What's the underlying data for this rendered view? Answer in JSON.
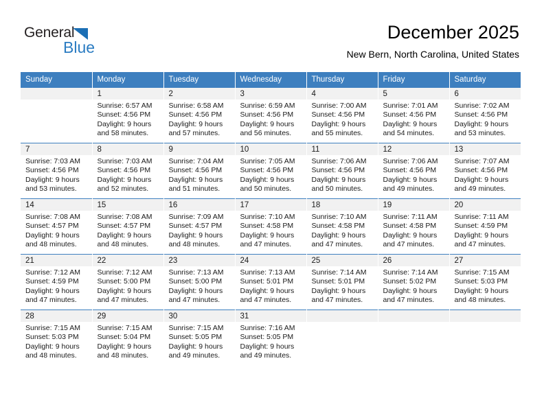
{
  "brand": {
    "name_part1": "General",
    "name_part2": "Blue",
    "accent_color": "#2b7cc2",
    "triangle_color": "#1c6fb5"
  },
  "header": {
    "title": "December 2025",
    "subtitle": "New Bern, North Carolina, United States"
  },
  "theme": {
    "header_row_bg": "#3d7fbf",
    "header_row_text": "#ffffff",
    "daynum_band_bg": "#f1f1f1",
    "cell_bg": "#ffffff",
    "row_divider": "#3d7fbf"
  },
  "calendar": {
    "weekday_headers": [
      "Sunday",
      "Monday",
      "Tuesday",
      "Wednesday",
      "Thursday",
      "Friday",
      "Saturday"
    ],
    "weeks": [
      [
        {
          "day": "",
          "lines": []
        },
        {
          "day": "1",
          "lines": [
            "Sunrise: 6:57 AM",
            "Sunset: 4:56 PM",
            "Daylight: 9 hours",
            "and 58 minutes."
          ]
        },
        {
          "day": "2",
          "lines": [
            "Sunrise: 6:58 AM",
            "Sunset: 4:56 PM",
            "Daylight: 9 hours",
            "and 57 minutes."
          ]
        },
        {
          "day": "3",
          "lines": [
            "Sunrise: 6:59 AM",
            "Sunset: 4:56 PM",
            "Daylight: 9 hours",
            "and 56 minutes."
          ]
        },
        {
          "day": "4",
          "lines": [
            "Sunrise: 7:00 AM",
            "Sunset: 4:56 PM",
            "Daylight: 9 hours",
            "and 55 minutes."
          ]
        },
        {
          "day": "5",
          "lines": [
            "Sunrise: 7:01 AM",
            "Sunset: 4:56 PM",
            "Daylight: 9 hours",
            "and 54 minutes."
          ]
        },
        {
          "day": "6",
          "lines": [
            "Sunrise: 7:02 AM",
            "Sunset: 4:56 PM",
            "Daylight: 9 hours",
            "and 53 minutes."
          ]
        }
      ],
      [
        {
          "day": "7",
          "lines": [
            "Sunrise: 7:03 AM",
            "Sunset: 4:56 PM",
            "Daylight: 9 hours",
            "and 53 minutes."
          ]
        },
        {
          "day": "8",
          "lines": [
            "Sunrise: 7:03 AM",
            "Sunset: 4:56 PM",
            "Daylight: 9 hours",
            "and 52 minutes."
          ]
        },
        {
          "day": "9",
          "lines": [
            "Sunrise: 7:04 AM",
            "Sunset: 4:56 PM",
            "Daylight: 9 hours",
            "and 51 minutes."
          ]
        },
        {
          "day": "10",
          "lines": [
            "Sunrise: 7:05 AM",
            "Sunset: 4:56 PM",
            "Daylight: 9 hours",
            "and 50 minutes."
          ]
        },
        {
          "day": "11",
          "lines": [
            "Sunrise: 7:06 AM",
            "Sunset: 4:56 PM",
            "Daylight: 9 hours",
            "and 50 minutes."
          ]
        },
        {
          "day": "12",
          "lines": [
            "Sunrise: 7:06 AM",
            "Sunset: 4:56 PM",
            "Daylight: 9 hours",
            "and 49 minutes."
          ]
        },
        {
          "day": "13",
          "lines": [
            "Sunrise: 7:07 AM",
            "Sunset: 4:56 PM",
            "Daylight: 9 hours",
            "and 49 minutes."
          ]
        }
      ],
      [
        {
          "day": "14",
          "lines": [
            "Sunrise: 7:08 AM",
            "Sunset: 4:57 PM",
            "Daylight: 9 hours",
            "and 48 minutes."
          ]
        },
        {
          "day": "15",
          "lines": [
            "Sunrise: 7:08 AM",
            "Sunset: 4:57 PM",
            "Daylight: 9 hours",
            "and 48 minutes."
          ]
        },
        {
          "day": "16",
          "lines": [
            "Sunrise: 7:09 AM",
            "Sunset: 4:57 PM",
            "Daylight: 9 hours",
            "and 48 minutes."
          ]
        },
        {
          "day": "17",
          "lines": [
            "Sunrise: 7:10 AM",
            "Sunset: 4:58 PM",
            "Daylight: 9 hours",
            "and 47 minutes."
          ]
        },
        {
          "day": "18",
          "lines": [
            "Sunrise: 7:10 AM",
            "Sunset: 4:58 PM",
            "Daylight: 9 hours",
            "and 47 minutes."
          ]
        },
        {
          "day": "19",
          "lines": [
            "Sunrise: 7:11 AM",
            "Sunset: 4:58 PM",
            "Daylight: 9 hours",
            "and 47 minutes."
          ]
        },
        {
          "day": "20",
          "lines": [
            "Sunrise: 7:11 AM",
            "Sunset: 4:59 PM",
            "Daylight: 9 hours",
            "and 47 minutes."
          ]
        }
      ],
      [
        {
          "day": "21",
          "lines": [
            "Sunrise: 7:12 AM",
            "Sunset: 4:59 PM",
            "Daylight: 9 hours",
            "and 47 minutes."
          ]
        },
        {
          "day": "22",
          "lines": [
            "Sunrise: 7:12 AM",
            "Sunset: 5:00 PM",
            "Daylight: 9 hours",
            "and 47 minutes."
          ]
        },
        {
          "day": "23",
          "lines": [
            "Sunrise: 7:13 AM",
            "Sunset: 5:00 PM",
            "Daylight: 9 hours",
            "and 47 minutes."
          ]
        },
        {
          "day": "24",
          "lines": [
            "Sunrise: 7:13 AM",
            "Sunset: 5:01 PM",
            "Daylight: 9 hours",
            "and 47 minutes."
          ]
        },
        {
          "day": "25",
          "lines": [
            "Sunrise: 7:14 AM",
            "Sunset: 5:01 PM",
            "Daylight: 9 hours",
            "and 47 minutes."
          ]
        },
        {
          "day": "26",
          "lines": [
            "Sunrise: 7:14 AM",
            "Sunset: 5:02 PM",
            "Daylight: 9 hours",
            "and 47 minutes."
          ]
        },
        {
          "day": "27",
          "lines": [
            "Sunrise: 7:15 AM",
            "Sunset: 5:03 PM",
            "Daylight: 9 hours",
            "and 48 minutes."
          ]
        }
      ],
      [
        {
          "day": "28",
          "lines": [
            "Sunrise: 7:15 AM",
            "Sunset: 5:03 PM",
            "Daylight: 9 hours",
            "and 48 minutes."
          ]
        },
        {
          "day": "29",
          "lines": [
            "Sunrise: 7:15 AM",
            "Sunset: 5:04 PM",
            "Daylight: 9 hours",
            "and 48 minutes."
          ]
        },
        {
          "day": "30",
          "lines": [
            "Sunrise: 7:15 AM",
            "Sunset: 5:05 PM",
            "Daylight: 9 hours",
            "and 49 minutes."
          ]
        },
        {
          "day": "31",
          "lines": [
            "Sunrise: 7:16 AM",
            "Sunset: 5:05 PM",
            "Daylight: 9 hours",
            "and 49 minutes."
          ]
        },
        {
          "day": "",
          "lines": []
        },
        {
          "day": "",
          "lines": []
        },
        {
          "day": "",
          "lines": []
        }
      ]
    ]
  }
}
